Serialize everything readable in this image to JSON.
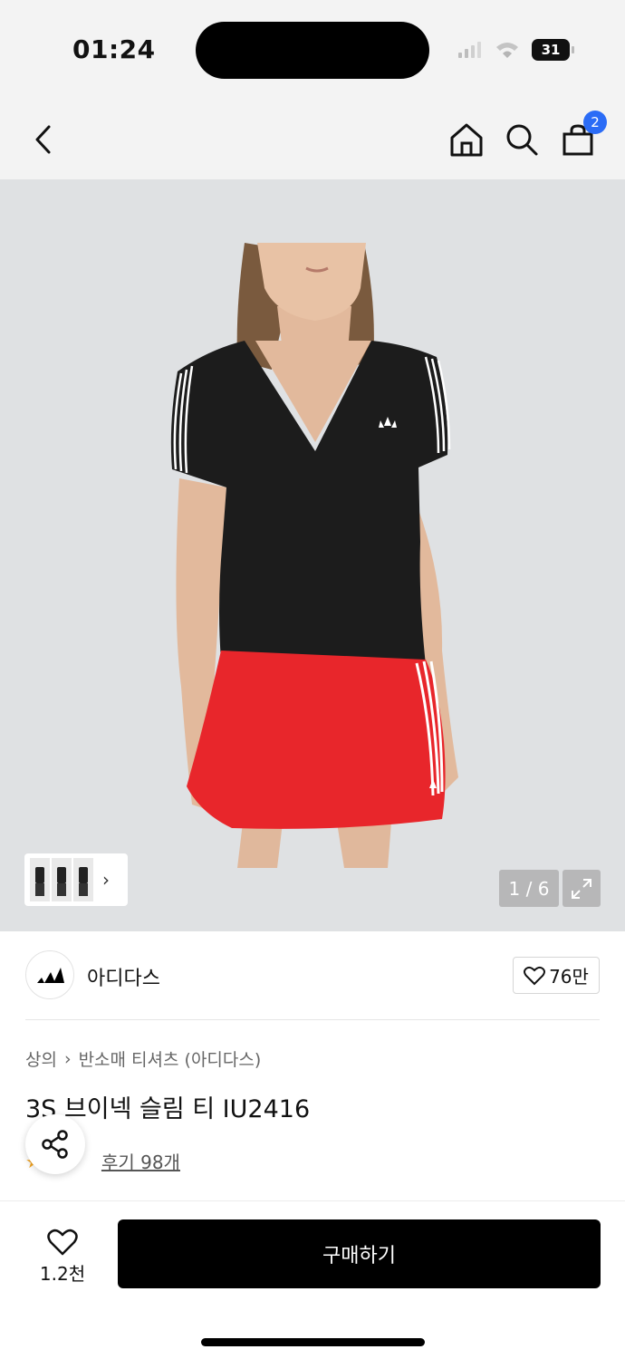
{
  "status_bar": {
    "time": "01:24",
    "battery": "31",
    "icons": [
      "signal-icon",
      "wifi-icon",
      "battery-icon"
    ]
  },
  "header": {
    "icons": [
      "back-icon",
      "home-icon",
      "search-icon",
      "bag-icon"
    ],
    "cart_badge": "2"
  },
  "gallery": {
    "page_indicator": "1 / 6",
    "thumbnail_more": "›"
  },
  "brand": {
    "name": "아디다스",
    "like_count": "76만"
  },
  "product": {
    "breadcrumb": [
      "상의",
      "반소매 티셔츠 (아디다스)"
    ],
    "breadcrumb_separator": "›",
    "title": "3S 브이넥 슬림 티 IU2416",
    "review_link": "후기 98개"
  },
  "bottom_bar": {
    "wish_count": "1.2천",
    "buy_label": "구매하기"
  },
  "colors": {
    "badge_blue": "#2b6cf6",
    "buy_button": "#000000",
    "skirt_red": "#e8262b",
    "image_bg": "#dfe1e3"
  }
}
